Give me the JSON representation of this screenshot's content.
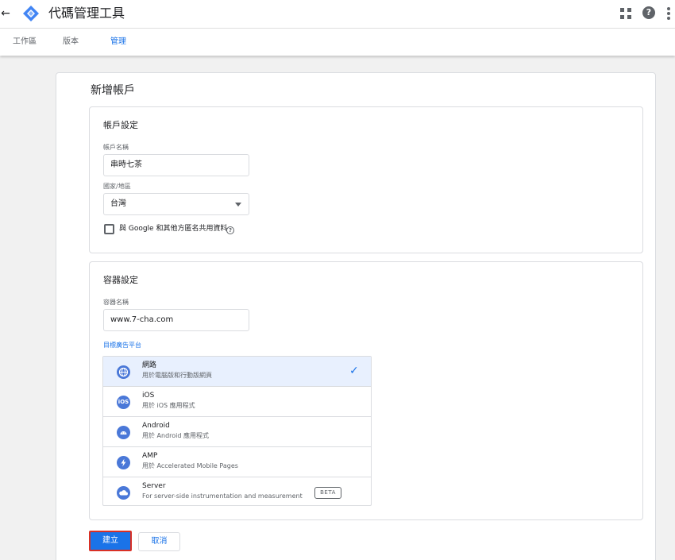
{
  "header": {
    "title": "代碼管理工具",
    "back_icon": "arrow-back-icon",
    "logo_icon": "tag-manager-logo",
    "actions": [
      "apps-grid-icon",
      "help-icon",
      "more-vert-icon"
    ],
    "help_glyph": "?"
  },
  "tabs": [
    {
      "label": "工作區",
      "active": false
    },
    {
      "label": "版本",
      "active": false
    },
    {
      "label": "管理",
      "active": true
    }
  ],
  "page": {
    "title": "新增帳戶"
  },
  "account": {
    "section_title": "帳戶設定",
    "name_label": "帳戶名稱",
    "name_value": "串時七茶",
    "country_label": "國家/地區",
    "country_value": "台灣",
    "share_checkbox_label": "與 Google 和其他方匿名共用資料",
    "share_checked": false
  },
  "container": {
    "section_title": "容器設定",
    "name_label": "容器名稱",
    "name_value": "www.7-cha.com",
    "platform_label": "目標廣告平台",
    "platforms": [
      {
        "name": "網路",
        "desc": "用於電腦版和行動版網頁",
        "icon": "globe-icon",
        "selected": true
      },
      {
        "name": "iOS",
        "desc": "用於 iOS 應用程式",
        "icon": "ios-icon",
        "icon_text": "iOS",
        "selected": false
      },
      {
        "name": "Android",
        "desc": "用於 Android 應用程式",
        "icon": "android-icon",
        "selected": false
      },
      {
        "name": "AMP",
        "desc": "用於 Accelerated Mobile Pages",
        "icon": "amp-bolt-icon",
        "selected": false
      },
      {
        "name": "Server",
        "desc": "For server-side instrumentation and measurement",
        "icon": "cloud-icon",
        "badge": "BETA",
        "selected": false
      }
    ]
  },
  "actions": {
    "create_label": "建立",
    "cancel_label": "取消"
  },
  "colors": {
    "accent": "#1a73e8",
    "selected_row": "#e8f0fe",
    "platform_icon": "#4a78d8",
    "highlight_border": "#d93025"
  }
}
